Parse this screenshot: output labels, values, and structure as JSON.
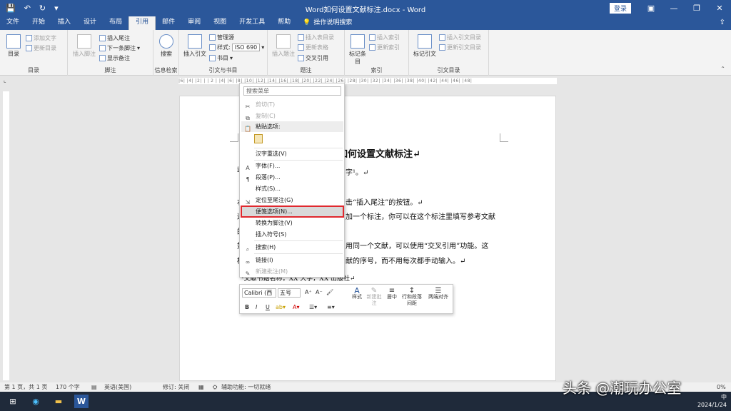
{
  "window": {
    "title": "Word如何设置文献标注.docx  -  Word",
    "login": "登录"
  },
  "tabs": [
    "文件",
    "开始",
    "插入",
    "设计",
    "布局",
    "引用",
    "邮件",
    "审阅",
    "视图",
    "开发工具",
    "帮助"
  ],
  "active_tab": "引用",
  "tell_me": "操作说明搜索",
  "ribbon": {
    "toc": {
      "big": "目录",
      "add_text": "添加文字",
      "update": "更新目录",
      "label": "目录"
    },
    "footnotes": {
      "big": "插入脚注",
      "insert_endnote": "插入尾注",
      "next_footnote": "下一条脚注",
      "show_notes": "显示备注",
      "label": "脚注"
    },
    "research": {
      "big": "搜索",
      "label": "信息检索"
    },
    "citations": {
      "big": "插入引文",
      "manage_sources": "管理源",
      "style_label": "样式:",
      "style_value": "ISO 690",
      "bibliography": "书目",
      "label": "引文与书目"
    },
    "captions": {
      "big": "插入题注",
      "insert_table_fig": "插入表目录",
      "update_table": "更新表格",
      "cross_ref": "交叉引用",
      "label": "题注"
    },
    "index": {
      "big": "标记条目",
      "insert_index": "插入索引",
      "update_index": "更新索引",
      "label": "索引"
    },
    "toa": {
      "big": "标记引文",
      "insert_toa": "插入引文目录",
      "update_toa": "更新引文目录",
      "label": "引文目录"
    }
  },
  "ruler_text": "|6| |4| |2| |  | 2 | |4| |6| |8| |10| |12| |14| |16| |18| |20| |22| |24| |26| |28| |30| |32| |34| |36| |38| |40| |42| |44| |46| |48|",
  "document": {
    "title_fragment": "如何设置文献标注↵",
    "line1_left": "i",
    "line1_right": "字¹。↵",
    "line3_left": "右",
    "line3_right": "击“插入尾注”的按钮。↵",
    "line4_left": "这",
    "line4_right": "加一个标注，你可以在这个标注里填写参考文献",
    "line5_left": "的",
    "line6_left": "如",
    "line6_right": "用同一个文献，可以使用“交叉引用”功能。这",
    "line7_left": "样",
    "line7_right": "献的序号，而不用每次都手动输入。↵",
    "footnote": "¹文献书籍名称，XX 大学，XX 出版社↵"
  },
  "context_menu": {
    "search": "搜索菜单",
    "items": [
      {
        "label": "剪切(T)",
        "icon": "✂",
        "disabled": true
      },
      {
        "label": "复制(C)",
        "icon": "⧉",
        "disabled": true
      },
      {
        "label": "粘贴选项:",
        "icon": "📋",
        "disabled": false
      },
      {
        "label": "汉字重选(V)",
        "icon": "",
        "disabled": false
      },
      {
        "label": "字体(F)...",
        "icon": "A",
        "disabled": false
      },
      {
        "label": "段落(P)...",
        "icon": "¶",
        "disabled": false
      },
      {
        "label": "样式(S)...",
        "icon": "",
        "disabled": false
      },
      {
        "label": "定位至尾注(G)",
        "icon": "⇲",
        "disabled": false
      },
      {
        "label": "便笺选项(N)...",
        "icon": "",
        "disabled": false
      },
      {
        "label": "转换为脚注(V)",
        "icon": "",
        "disabled": false
      },
      {
        "label": "插入符号(S)",
        "icon": "",
        "disabled": false
      },
      {
        "label": "搜索(H)",
        "icon": "⌕",
        "disabled": false
      },
      {
        "label": "链接(I)",
        "icon": "∞",
        "disabled": false
      },
      {
        "label": "新建批注(M)",
        "icon": "✎",
        "disabled": true
      }
    ]
  },
  "mini_toolbar": {
    "font": "Calibri (西",
    "size": "五号",
    "styles": "样式",
    "new_comment": "新建批注",
    "center": "居中",
    "line_spacing": "行和段落间距",
    "justify": "两端对齐"
  },
  "status": {
    "page": "第 1 页，共 1 页",
    "words": "170 个字",
    "language": "英语(美国)",
    "revisions": "修订: 关闭",
    "accessibility": "辅助功能: 一切就绪",
    "zoom": "0%"
  },
  "tray": {
    "ime": "中",
    "date": "2024/1/24"
  },
  "watermark": "头条 @潮玩办公室"
}
